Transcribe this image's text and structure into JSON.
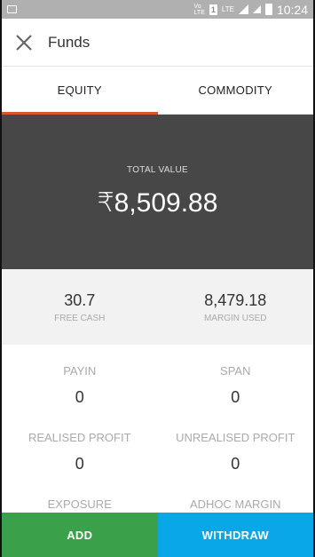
{
  "status_bar": {
    "time": "10:24",
    "lte_small": "LTE",
    "sim_number": "1"
  },
  "app_bar": {
    "title": "Funds",
    "close_icon": "close-icon"
  },
  "tabs": [
    {
      "label": "EQUITY",
      "active": true
    },
    {
      "label": "COMMODITY",
      "active": false
    }
  ],
  "total": {
    "label": "TOTAL VALUE",
    "value": "₹8,509.88"
  },
  "cash": {
    "free_cash_value": "30.7",
    "free_cash_label": "FREE CASH",
    "margin_used_value": "8,479.18",
    "margin_used_label": "MARGIN USED"
  },
  "details": [
    {
      "label": "PAYIN",
      "value": "0"
    },
    {
      "label": "SPAN",
      "value": "0"
    },
    {
      "label": "REALISED PROFIT",
      "value": "0"
    },
    {
      "label": "UNREALISED PROFIT",
      "value": "0"
    },
    {
      "label": "EXPOSURE",
      "value": ""
    },
    {
      "label": "ADHOC MARGIN",
      "value": ""
    }
  ],
  "actions": {
    "add_label": "ADD",
    "withdraw_label": "WITHDRAW"
  },
  "colors": {
    "tab_indicator": "#e0522b",
    "total_bg": "#474747",
    "add": "#3aa04a",
    "withdraw": "#0aa7e8"
  }
}
